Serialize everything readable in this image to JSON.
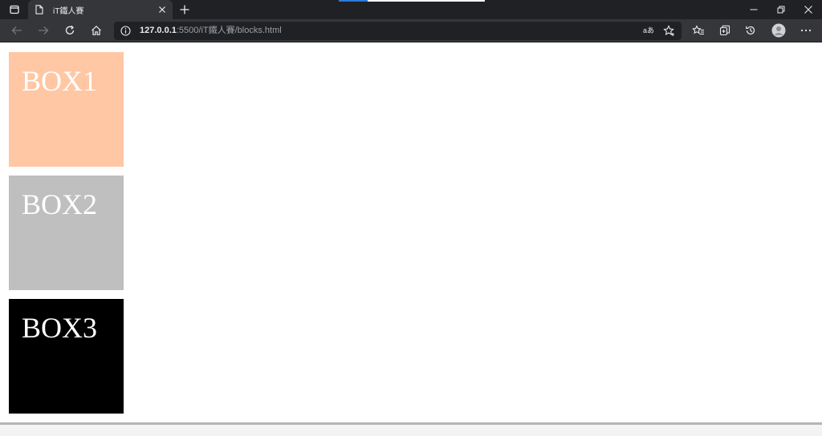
{
  "browser": {
    "tab": {
      "title": "iT鐵人賽"
    },
    "address": {
      "host": "127.0.0.1",
      "rest": ":5500/iT鐵人賽/blocks.html"
    },
    "read_aloud_label": "aあ"
  },
  "page": {
    "boxes": [
      {
        "label": "BOX1",
        "color": "#ffc7a3"
      },
      {
        "label": "BOX2",
        "color": "#bfbfbf"
      },
      {
        "label": "BOX3",
        "color": "#000000"
      }
    ]
  },
  "colors": {
    "titlebar": "#202124",
    "toolbar": "#35363a",
    "omnibox": "#202124"
  }
}
